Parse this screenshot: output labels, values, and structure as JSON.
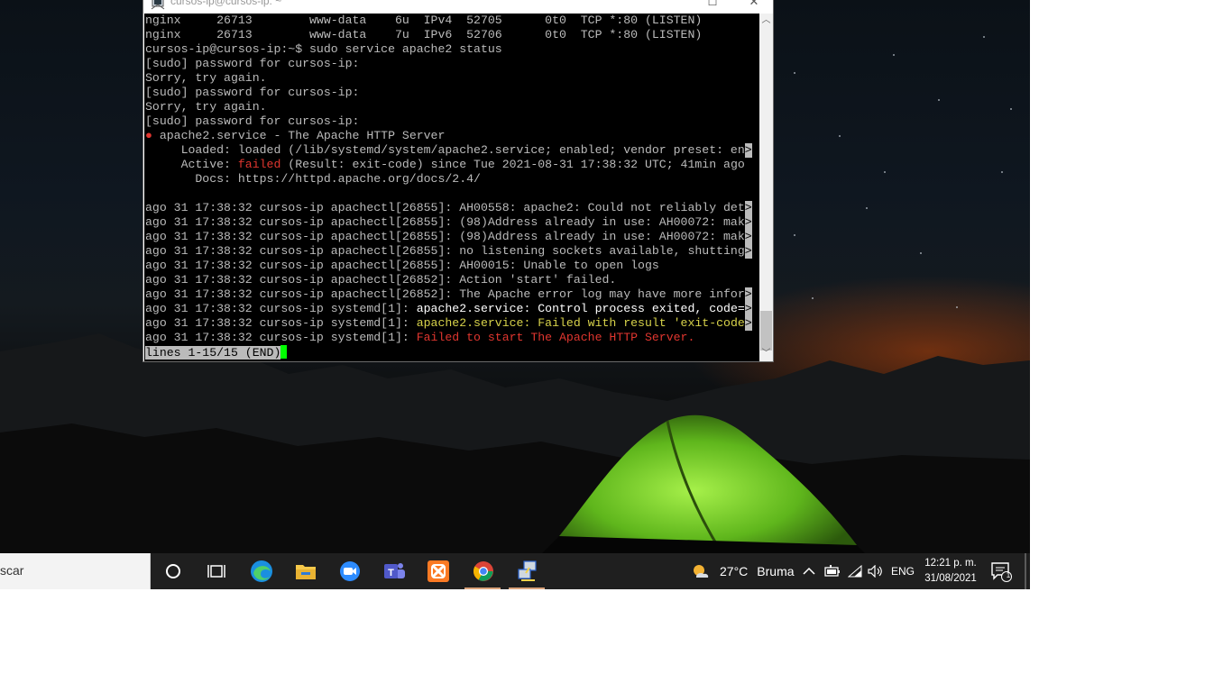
{
  "window": {
    "title": "cursos-ip@cursos-ip: ~",
    "maximize_icon": "maximize-icon",
    "close_icon": "close-icon"
  },
  "terminal": {
    "lines": [
      {
        "segments": [
          {
            "t": "nginx     26713        www-data    6u  IPv4  52705      0t0  TCP *:80 (LISTEN)"
          }
        ]
      },
      {
        "segments": [
          {
            "t": "nginx     26713        www-data    7u  IPv6  52706      0t0  TCP *:80 (LISTEN)"
          }
        ]
      },
      {
        "segments": [
          {
            "t": "cursos-ip@cursos-ip:~$ sudo service apache2 status"
          }
        ]
      },
      {
        "segments": [
          {
            "t": "[sudo] password for cursos-ip:"
          }
        ]
      },
      {
        "segments": [
          {
            "t": "Sorry, try again."
          }
        ]
      },
      {
        "segments": [
          {
            "t": "[sudo] password for cursos-ip:"
          }
        ]
      },
      {
        "segments": [
          {
            "t": "Sorry, try again."
          }
        ]
      },
      {
        "segments": [
          {
            "t": "[sudo] password for cursos-ip:"
          }
        ]
      },
      {
        "segments": [
          {
            "t": "●",
            "c": "red"
          },
          {
            "t": " apache2.service - The Apache HTTP Server"
          }
        ]
      },
      {
        "segments": [
          {
            "t": "     Loaded: loaded (/lib/systemd/system/apache2.service; enabled; vendor preset: en"
          },
          {
            "t": ">",
            "c": "trunc"
          }
        ]
      },
      {
        "segments": [
          {
            "t": "     Active: "
          },
          {
            "t": "failed",
            "c": "red"
          },
          {
            "t": " (Result: exit-code) since Tue 2021-08-31 17:38:32 UTC; 41min ago"
          }
        ]
      },
      {
        "segments": [
          {
            "t": "       Docs: https://httpd.apache.org/docs/2.4/"
          }
        ]
      },
      {
        "segments": [
          {
            "t": ""
          }
        ]
      },
      {
        "segments": [
          {
            "t": "ago 31 17:38:32 cursos-ip apachectl[26855]: AH00558: apache2: Could not reliably det"
          },
          {
            "t": ">",
            "c": "trunc"
          }
        ]
      },
      {
        "segments": [
          {
            "t": "ago 31 17:38:32 cursos-ip apachectl[26855]: (98)Address already in use: AH00072: mak"
          },
          {
            "t": ">",
            "c": "trunc"
          }
        ]
      },
      {
        "segments": [
          {
            "t": "ago 31 17:38:32 cursos-ip apachectl[26855]: (98)Address already in use: AH00072: mak"
          },
          {
            "t": ">",
            "c": "trunc"
          }
        ]
      },
      {
        "segments": [
          {
            "t": "ago 31 17:38:32 cursos-ip apachectl[26855]: no listening sockets available, shutting"
          },
          {
            "t": ">",
            "c": "trunc"
          }
        ]
      },
      {
        "segments": [
          {
            "t": "ago 31 17:38:32 cursos-ip apachectl[26855]: AH00015: Unable to open logs"
          }
        ]
      },
      {
        "segments": [
          {
            "t": "ago 31 17:38:32 cursos-ip apachectl[26852]: Action 'start' failed."
          }
        ]
      },
      {
        "segments": [
          {
            "t": "ago 31 17:38:32 cursos-ip apachectl[26852]: The Apache error log may have more infor"
          },
          {
            "t": ">",
            "c": "trunc"
          }
        ]
      },
      {
        "segments": [
          {
            "t": "ago 31 17:38:32 cursos-ip systemd[1]: "
          },
          {
            "t": "apache2.service: Control process exited, code=",
            "c": "white"
          },
          {
            "t": ">",
            "c": "trunc"
          }
        ]
      },
      {
        "segments": [
          {
            "t": "ago 31 17:38:32 cursos-ip systemd[1]: "
          },
          {
            "t": "apache2.service: Failed with result 'exit-code",
            "c": "yellow"
          },
          {
            "t": ">",
            "c": "trunc"
          }
        ]
      },
      {
        "segments": [
          {
            "t": "ago 31 17:38:32 cursos-ip systemd[1]: "
          },
          {
            "t": "Failed to start The Apache HTTP Server.",
            "c": "red"
          }
        ]
      }
    ],
    "status_line": "lines 1-15/15 (END)"
  },
  "scrollbar": {
    "up_icon": "scroll-up-icon",
    "down_icon": "scroll-down-icon"
  },
  "taskbar": {
    "search_text": "scar",
    "icons": [
      "cortana-icon",
      "task-view-icon",
      "edge-icon",
      "file-explorer-icon",
      "zoom-icon",
      "teams-icon",
      "xampp-icon",
      "chrome-icon",
      "putty-icon"
    ],
    "weather": {
      "temp": "27°C",
      "condition": "Bruma"
    },
    "language": "ENG",
    "time": "12:21 p. m.",
    "date": "31/08/2021",
    "notification_count": "1"
  }
}
